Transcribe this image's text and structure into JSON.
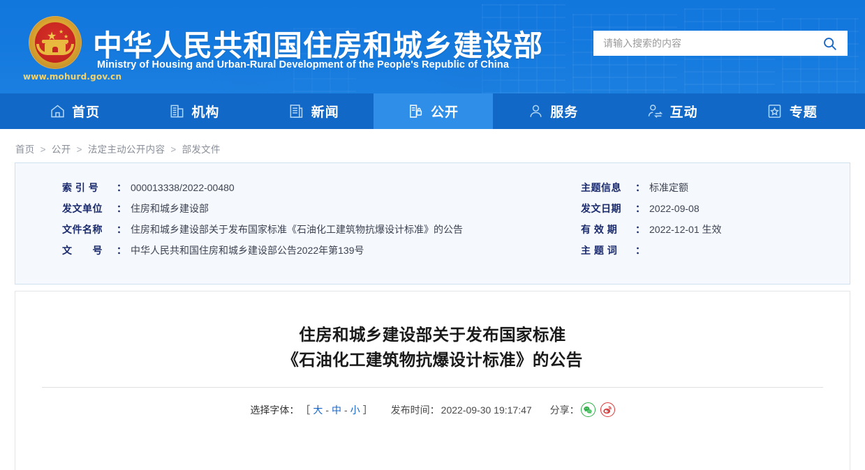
{
  "site": {
    "emblem_icon": "national-emblem-icon",
    "url": "www.mohurd.gov.cn",
    "title": "中华人民共和国住房和城乡建设部",
    "subtitle": "Ministry of Housing and Urban-Rural Development of the People's Republic of China"
  },
  "search": {
    "placeholder": "请输入搜索的内容",
    "value": "",
    "icon": "search-icon"
  },
  "nav": {
    "items": [
      {
        "label": "首页",
        "icon": "home-icon",
        "active": false
      },
      {
        "label": "机构",
        "icon": "building-icon",
        "active": false
      },
      {
        "label": "新闻",
        "icon": "news-document-icon",
        "active": false
      },
      {
        "label": "公开",
        "icon": "open-disclosure-icon",
        "active": true
      },
      {
        "label": "服务",
        "icon": "service-person-icon",
        "active": false
      },
      {
        "label": "互动",
        "icon": "interaction-exchange-icon",
        "active": false
      },
      {
        "label": "专题",
        "icon": "star-topic-icon",
        "active": false
      }
    ]
  },
  "breadcrumb": {
    "items": [
      "首页",
      "公开",
      "法定主动公开内容",
      "部发文件"
    ],
    "separator": ">"
  },
  "info": {
    "left": [
      {
        "label": "索 引 号",
        "value": "000013338/2022-00480"
      },
      {
        "label": "发文单位",
        "value": "住房和城乡建设部"
      },
      {
        "label": "文件名称",
        "value": "住房和城乡建设部关于发布国家标准《石油化工建筑物抗爆设计标准》的公告"
      },
      {
        "label": "文　　号",
        "value": "中华人民共和国住房和城乡建设部公告2022年第139号"
      }
    ],
    "right": [
      {
        "label": "主题信息",
        "value": "标准定额"
      },
      {
        "label": "发文日期",
        "value": "2022-09-08"
      },
      {
        "label": "有 效 期",
        "value": "2022-12-01 生效"
      },
      {
        "label": "主 题 词",
        "value": ""
      }
    ],
    "colon": "："
  },
  "article": {
    "title_line1": "住房和城乡建设部关于发布国家标准",
    "title_line2": "《石油化工建筑物抗爆设计标准》的公告",
    "font_size_label": "选择字体：",
    "bracket_open": "［",
    "bracket_close": "］",
    "font_large": "大",
    "font_medium": "中",
    "font_small": "小",
    "dash": "-",
    "publish_label": "发布时间：",
    "publish_time": "2022-09-30 19:17:47",
    "share_label": "分享：",
    "share_wechat_icon": "wechat-share-icon",
    "share_weibo_icon": "weibo-share-icon"
  },
  "colors": {
    "header_blue": "#1479de",
    "nav_blue": "#1168c6",
    "nav_active_blue": "#2f8ee8",
    "link_blue": "#1765c4",
    "info_bg": "#f5f9fd",
    "info_border": "#cfe0ef",
    "label_navy": "#1a2a6c",
    "wechat_green": "#2fae4a",
    "weibo_red": "#d8383a",
    "emblem_gold": "#e9b83e",
    "emblem_red": "#c5251f"
  }
}
